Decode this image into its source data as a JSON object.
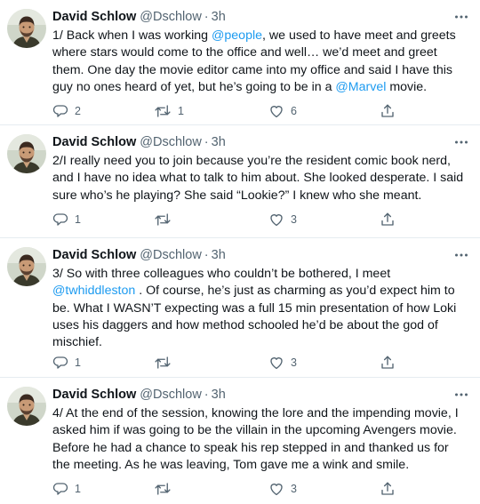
{
  "tweets": [
    {
      "name": "David Schlow",
      "handle": "@Dschlow",
      "time": "3h",
      "body": [
        {
          "t": "1/ Back when I was working "
        },
        {
          "t": "@people",
          "m": true
        },
        {
          "t": ", we used to have meet and greets where stars would come to the office and well… we’d meet and greet them. One day the movie editor came into my office and said I have this guy no ones heard of yet, but he’s going to be in a "
        },
        {
          "t": "@Marvel",
          "m": true
        },
        {
          "t": " movie."
        }
      ],
      "replies": "2",
      "retweets": "1",
      "likes": "6"
    },
    {
      "name": "David Schlow",
      "handle": "@Dschlow",
      "time": "3h",
      "body": [
        {
          "t": "2/I really need you to join because you’re the resident comic book nerd, and I have no idea what to talk to him about. She looked desperate. I said sure who’s he playing? She said “Lookie?” I knew who she meant."
        }
      ],
      "replies": "1",
      "retweets": "",
      "likes": "3"
    },
    {
      "name": "David Schlow",
      "handle": "@Dschlow",
      "time": "3h",
      "body": [
        {
          "t": "3/ So with three colleagues who couldn’t be bothered, I meet "
        },
        {
          "t": "@twhiddleston",
          "m": true
        },
        {
          "t": " . Of course, he’s just as charming as you’d expect him to be. What I WASN’T expecting was a full 15 min presentation of how Loki uses his daggers and how method schooled he’d be about the god of mischief."
        }
      ],
      "replies": "1",
      "retweets": "",
      "likes": "3"
    },
    {
      "name": "David Schlow",
      "handle": "@Dschlow",
      "time": "3h",
      "body": [
        {
          "t": "4/ At the end of the session, knowing the lore and the impending movie, I asked him if was going to be the villain in the upcoming Avengers movie. Before he had a chance to speak his rep stepped in and thanked us for the meeting. As he was leaving, Tom gave me a wink and smile."
        }
      ],
      "replies": "1",
      "retweets": "",
      "likes": "3"
    }
  ],
  "separator": "·",
  "icons": {
    "more": "more-dots-icon",
    "reply": "reply-bubble-icon",
    "retweet": "retweet-icon",
    "like": "heart-icon",
    "share": "share-upload-icon"
  },
  "colors": {
    "text": "#0f1419",
    "secondary": "#536471",
    "mention": "#1d9bf0",
    "divider": "#e6ecf0"
  }
}
